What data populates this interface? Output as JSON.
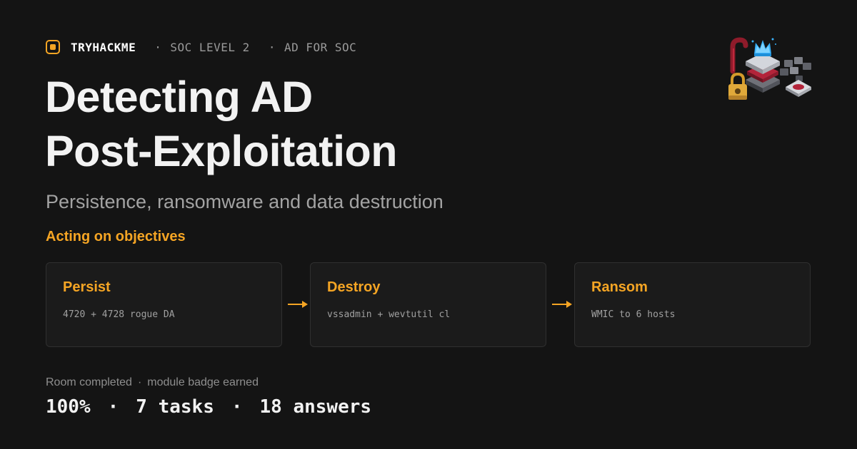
{
  "header": {
    "brand": "TRYHACKME",
    "crumbs": [
      {
        "sep": "·",
        "label": "SOC LEVEL 2"
      },
      {
        "sep": "·",
        "label": "AD FOR SOC"
      }
    ]
  },
  "title": {
    "line1": "Detecting AD",
    "line2": "Post-Exploitation"
  },
  "subtitle": "Persistence, ransomware and data destruction",
  "section_label": "Acting on objectives",
  "steps": [
    {
      "title": "Persist",
      "desc": "4720 + 4728 rogue DA"
    },
    {
      "title": "Destroy",
      "desc": "vssadmin + wevtutil cl"
    },
    {
      "title": "Ransom",
      "desc": "WMIC to 6 hosts"
    }
  ],
  "status": {
    "left": "Room completed",
    "sep": "·",
    "right": "module badge earned"
  },
  "stats": {
    "progress": "100%",
    "tasks": "7 tasks",
    "answers": "18 answers",
    "sep": "·"
  },
  "colors": {
    "accent": "#f5a524",
    "background": "#141414",
    "card": "#1b1b1b"
  },
  "icons": {
    "logo": "tryhackme-logo-icon",
    "illustration": "active-directory-crown-server-illustration"
  }
}
